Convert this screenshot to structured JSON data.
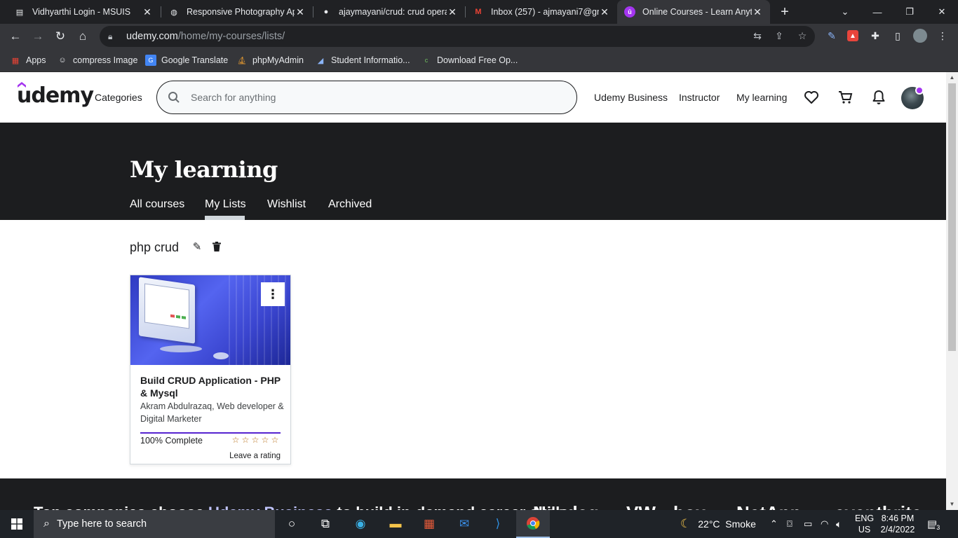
{
  "browser": {
    "tabs": [
      {
        "title": "Vidhyarthi Login - MSUIS",
        "favicon": "document-icon"
      },
      {
        "title": "Responsive Photography App",
        "favicon": "globe-icon"
      },
      {
        "title": "ajaymayani/crud: crud operati",
        "favicon": "github-icon"
      },
      {
        "title": "Inbox (257) - ajmayani7@gm",
        "favicon": "gmail-icon"
      },
      {
        "title": "Online Courses - Learn Anyth",
        "favicon": "udemy-icon",
        "active": true
      }
    ],
    "url": {
      "host": "udemy.com",
      "path": "/home/my-courses/lists/"
    },
    "bookmarks": [
      {
        "label": "Apps",
        "icon": "apps-grid-icon"
      },
      {
        "label": "compress Image",
        "icon": "compress-icon"
      },
      {
        "label": "Google Translate",
        "icon": "translate-icon"
      },
      {
        "label": "phpMyAdmin",
        "icon": "phpmyadmin-icon"
      },
      {
        "label": "Student Informatio...",
        "icon": "student-icon"
      },
      {
        "label": "Download Free Op...",
        "icon": "download-icon"
      }
    ]
  },
  "header": {
    "logo": "udemy",
    "categories": "Categories",
    "search_placeholder": "Search for anything",
    "links": {
      "business": "Udemy Business",
      "instructor": "Instructor",
      "my_learning": "My learning"
    }
  },
  "banner": {
    "title": "My learning",
    "tabs": [
      {
        "label": "All courses"
      },
      {
        "label": "My Lists",
        "active": true
      },
      {
        "label": "Wishlist"
      },
      {
        "label": "Archived"
      }
    ]
  },
  "list": {
    "name": "php crud",
    "course": {
      "title": "Build CRUD Application - PHP & Mysql",
      "author": "Akram Abdulrazaq, Web developer & Digital Marketer",
      "progress_percent": 100,
      "progress_label": "100% Complete",
      "stars": 5,
      "rating_label": "Leave a rating"
    }
  },
  "footer": {
    "text_before": "Top companies choose ",
    "text_highlight": "Udemy Business",
    "text_after": " to build in-demand career skills.",
    "logos": [
      "Nasdaq",
      "VW",
      "box",
      "NetApp",
      "eventbrite"
    ]
  },
  "taskbar": {
    "search_placeholder": "Type here to search",
    "weather": "22°C  Smoke",
    "lang_top": "ENG",
    "lang_bottom": "US",
    "time": "8:46 PM",
    "date": "2/4/2022",
    "notifications": "3"
  },
  "colors": {
    "brand": "#a435f0",
    "progress": "#5624d0",
    "banner_bg": "#1c1d1f",
    "star": "#b4690e"
  }
}
